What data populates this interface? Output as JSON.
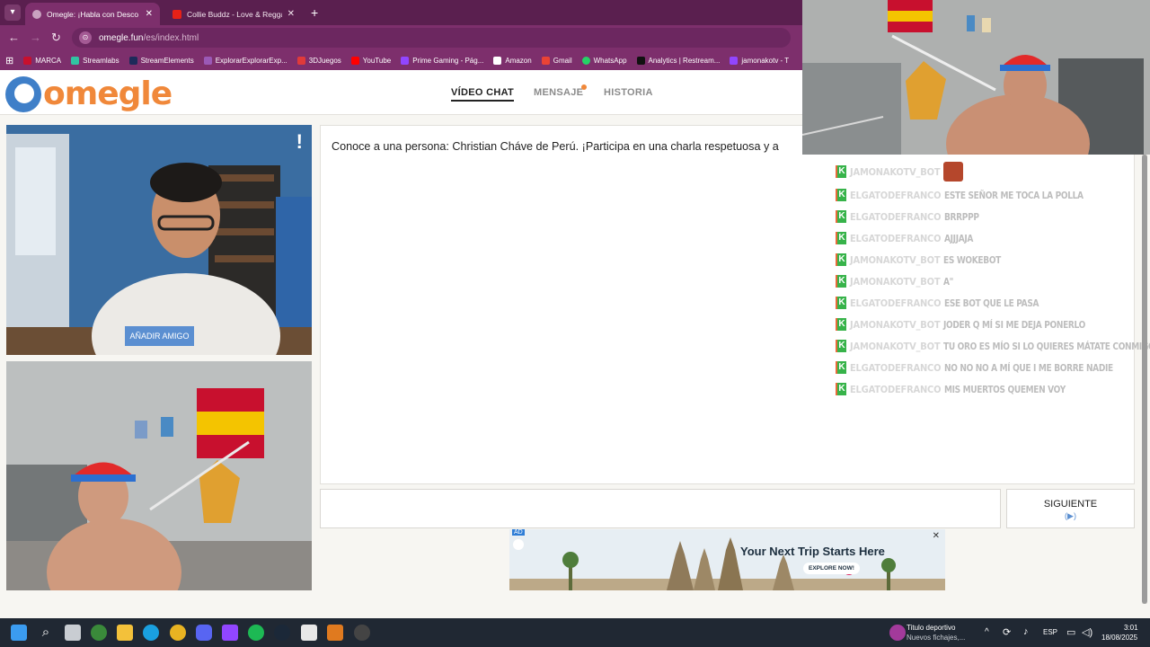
{
  "browser": {
    "tabs": [
      {
        "title": "Omegle: ¡Habla con Desco",
        "active": true
      },
      {
        "title": "Collie Buddz - Love & Reggae",
        "active": false
      }
    ],
    "new_tab": "+",
    "url_host": "omegle.fun",
    "url_path": "/es/index.html",
    "bookmarks": [
      "MARCA",
      "Streamlabs",
      "StreamElements",
      "ExplorarExplorarExp...",
      "3DJuegos",
      "YouTube",
      "Prime Gaming - Pág...",
      "Amazon",
      "Gmail",
      "WhatsApp",
      "Analytics | Restream...",
      "jamonakotv - T"
    ]
  },
  "site": {
    "logo": "omegle",
    "nav": {
      "video_chat": "VÍDEO CHAT",
      "message": "MENSAJE",
      "history": "HISTORIA"
    },
    "report_icon": "!",
    "add_friend": "AÑADIR AMIGO",
    "chat_intro": "Conoce a una persona: Christian Cháve de Perú. ¡Participa en una charla respetuosa y a",
    "next_button": "SIGUIENTE",
    "next_sub": "(▶)",
    "ad": {
      "badge": "AD",
      "headline": "Your Next Trip Starts Here",
      "cta": "EXPLORE NOW!",
      "close": "✕"
    }
  },
  "stream_chat": [
    {
      "user": "JAMONAKOTV_BOT",
      "message": ""
    },
    {
      "user": "ELGATODEFRANCO",
      "message": "ESTE SEÑOR ME TOCA LA POLLA"
    },
    {
      "user": "ELGATODEFRANCO",
      "message": "BRRPPP"
    },
    {
      "user": "ELGATODEFRANCO",
      "message": "AJJJAJA"
    },
    {
      "user": "JAMONAKOTV_BOT",
      "message": "ES WOKEBOT"
    },
    {
      "user": "JAMONAKOTV_BOT",
      "message": "A\""
    },
    {
      "user": "ELGATODEFRANCO",
      "message": "ESE BOT QUE LE PASA"
    },
    {
      "user": "JAMONAKOTV_BOT",
      "message": "JODER Q MÍ SI ME DEJA PONERLO"
    },
    {
      "user": "JAMONAKOTV_BOT",
      "message": "TU ORO ES MÍO SI LO QUIERES MÁTATE CONMIGO"
    },
    {
      "user": "ELGATODEFRANCO",
      "message": "NO NO NO A MÍ QUE I ME BORRE NADIE"
    },
    {
      "user": "ELGATODEFRANCO",
      "message": "MIS MUERTOS QUEMEN VOY"
    }
  ],
  "taskbar": {
    "weather_title": "Titulo deportivo",
    "weather_sub": "Nuevos fichajes,...",
    "lang": "ESP",
    "time": "3:01",
    "date": "18/08/2025"
  }
}
